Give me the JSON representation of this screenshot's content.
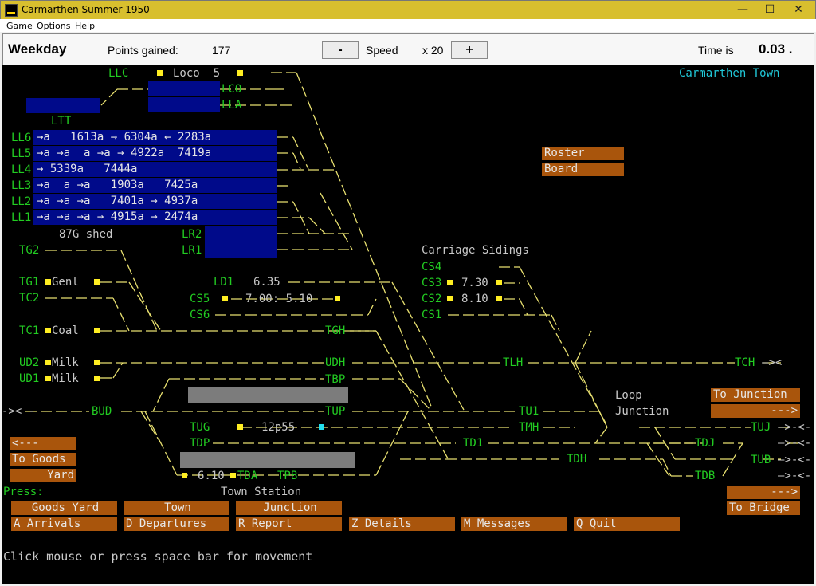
{
  "window": {
    "title": "Carmarthen Summer 1950",
    "minimize": "—",
    "maximize": "☐",
    "close": "✕"
  },
  "menu": [
    "Game",
    "Options",
    "Help"
  ],
  "status": {
    "day": "Weekday",
    "points_label": "Points gained:",
    "points": "177",
    "speed_minus": "-",
    "speed_label": "Speed",
    "speed_value": "x 20",
    "speed_plus": "+",
    "time_label": "Time is",
    "time_value": "0.03 ."
  },
  "board": {
    "station_name": "Carmarthen Town",
    "llc": "LLC",
    "loco_label": "Loco  5",
    "lco": "LCO",
    "lla": "LLA",
    "ltt": "LTT",
    "loco_lines": [
      {
        "name": "LL6",
        "trains": "→a   1613a → 6304a ← 2283a"
      },
      {
        "name": "LL5",
        "trains": "→a →a  a →a → 4922a  7419a"
      },
      {
        "name": "LL4",
        "trains": "→ 5339a   7444a"
      },
      {
        "name": "LL3",
        "trains": "→a  a →a   1903a   7425a"
      },
      {
        "name": "LL2",
        "trains": "→a →a →a   7401a → 4937a"
      },
      {
        "name": "LL1",
        "trains": "→a →a →a → 4915a → 2474a"
      }
    ],
    "shed": "87G shed",
    "lr2": "LR2",
    "lr1": "LR1",
    "carriage_sidings": "Carriage Sidings",
    "cs4": "CS4",
    "cs3": "CS3",
    "cs3_time": "7.30",
    "cs2": "CS2",
    "cs2_time": "8.10",
    "cs1": "CS1",
    "tg2": "TG2",
    "tg1": "TG1",
    "genl": "Genl",
    "tc2": "TC2",
    "tc1": "TC1",
    "coal": "Coal",
    "ld1": "LD1",
    "ld1_time": "6.35",
    "cs5": "CS5",
    "cs5_times": "7.00: 5.10",
    "cs6": "CS6",
    "tgh": "TGH",
    "udh": "UDH",
    "tlh": "TLH",
    "tch": "TCH",
    "tch_arrow": "—><",
    "ud2": "UD2",
    "ud1": "UD1",
    "milk": "Milk",
    "tbp": "TBP",
    "tup": "TUP",
    "tu1": "TU1",
    "tmh": "TMH",
    "td1": "TD1",
    "tdh": "TDH",
    "bud": "BUD",
    "left_arrow": "->< -",
    "tug": "TUG",
    "tug_time": "12p55",
    "tdp": "TDP",
    "tda": "TDA",
    "tda_time": "6.10",
    "tpb": "TPB",
    "town_station": "Town Station",
    "loop_junction_1": "Loop",
    "loop_junction_2": "Junction",
    "tuj": "TUJ",
    "tdj": "TDJ",
    "tub": "TUB",
    "tdb": "TDB",
    "out_arrow": "—>-<-",
    "press": "Press:",
    "footer": "Click mouse or press space bar for movement"
  },
  "buttons": {
    "roster": "Roster",
    "board": "Board",
    "to_junction": "To Junction",
    "to_junction_arrow": "--->",
    "to_bridge_arrow": "--->",
    "to_bridge": "To Bridge",
    "goods_arrow": "<---",
    "to_goods": "To Goods",
    "yard": "Yard",
    "goods_yard": "Goods Yard",
    "town": "Town",
    "junction": "Junction",
    "arrivals": "A Arrivals",
    "departures": "D Departures",
    "report": "R Report",
    "details": "Z Details",
    "messages": "M Messages",
    "quit": "Q Quit"
  },
  "colors": {
    "track": "#e8e070",
    "label": "#22cc22",
    "button": "#a9550c",
    "siding": "#000a8a",
    "station": "#20c8d8"
  }
}
